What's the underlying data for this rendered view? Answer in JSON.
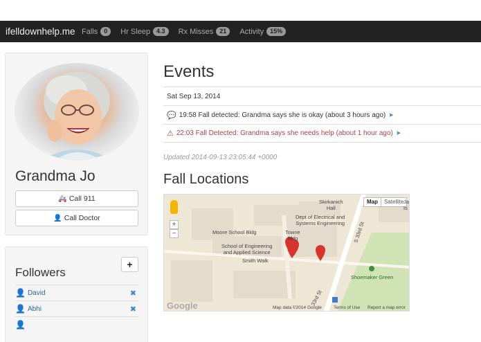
{
  "nav": {
    "brand": "ifelldownhelp.me",
    "items": [
      {
        "label": "Falls",
        "badge": "0"
      },
      {
        "label": "Hr Sleep",
        "badge": "4.3"
      },
      {
        "label": "Rx Misses",
        "badge": "21"
      },
      {
        "label": "Activity",
        "badge": "15%"
      }
    ]
  },
  "profile": {
    "name": "Grandma Jo",
    "call_911": "Call 911",
    "call_doctor": "Call Doctor"
  },
  "followers": {
    "title": "Followers",
    "add_label": "+",
    "items": [
      {
        "name": "David"
      },
      {
        "name": "Abhi"
      }
    ]
  },
  "events": {
    "title": "Events",
    "date": "Sat Sep 13, 2014",
    "items": [
      {
        "text": "19:58 Fall detected: Grandma says she is okay (about 3 hours ago)",
        "icon": "comment-icon",
        "level": "normal"
      },
      {
        "text": "22:03 Fall Detected: Grandma says she needs help (about 1 hour ago)",
        "icon": "warning-icon",
        "level": "danger"
      }
    ],
    "updated": "Updated 2014-09-13 23:05:44 +0000"
  },
  "fall_locations": {
    "title": "Fall Locations",
    "map": {
      "type_buttons": [
        "Map",
        "Satellite"
      ],
      "zoom_in": "+",
      "zoom_out": "−",
      "labels": {
        "skirkanich": "Skirkanich\nHall",
        "dept": "Dept of Electrical and\nSystems Engineering",
        "moore": "Moore School Bldg",
        "towne": "Towne\nBldg",
        "seas": "School of Engineering\nand Applied Science",
        "smith": "Smith Walk",
        "street33": "S 33rd St",
        "street33b": "33rd St",
        "shoemaker": "Shoemaker Green",
        "edge": "Ja\nIs"
      },
      "logo": "Google",
      "attribution": [
        "Map data ©2014 Google",
        "Terms of Use",
        "Report a map error"
      ]
    }
  },
  "colors": {
    "navbar": "#222222",
    "danger": "#a94442",
    "link": "#2a6496",
    "pin": "#d9342b"
  }
}
